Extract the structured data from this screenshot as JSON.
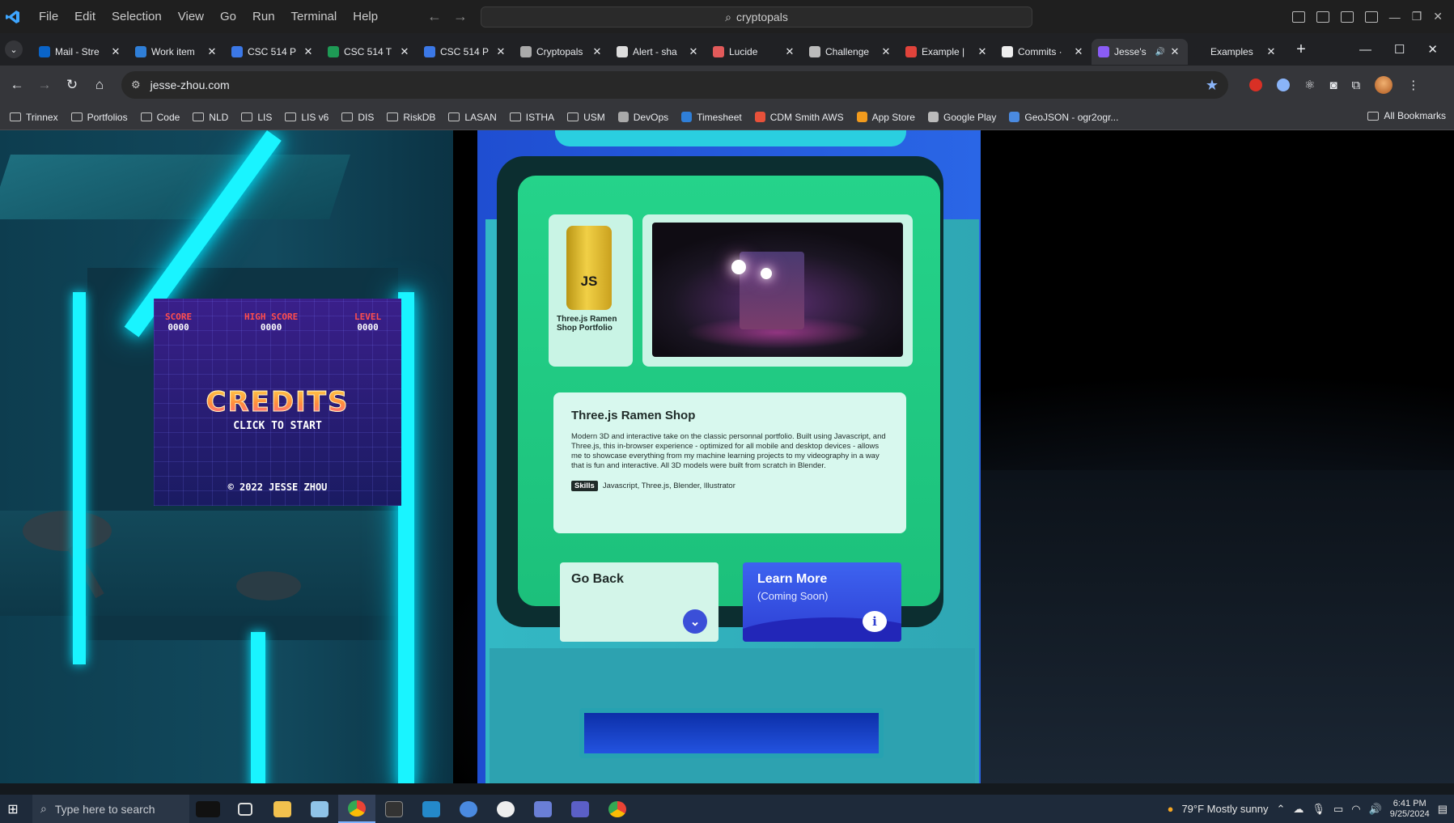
{
  "vscode": {
    "menu": [
      "File",
      "Edit",
      "Selection",
      "View",
      "Go",
      "Run",
      "Terminal",
      "Help"
    ],
    "search": "cryptopals"
  },
  "browser": {
    "tabs": [
      {
        "title": "Mail - Stre",
        "color": "#0a64c8"
      },
      {
        "title": "Work item",
        "color": "#2f7fd8"
      },
      {
        "title": "CSC 514 P",
        "color": "#3b78e7"
      },
      {
        "title": "CSC 514 T",
        "color": "#1e9a55"
      },
      {
        "title": "CSC 514 P",
        "color": "#3b78e7"
      },
      {
        "title": "Cryptopals",
        "color": "#aaaaaa"
      },
      {
        "title": "Alert - sha",
        "color": "#dddddd"
      },
      {
        "title": "Lucide",
        "color": "#e25a5a"
      },
      {
        "title": "Challenge",
        "color": "#bbbbbb"
      },
      {
        "title": "Example |",
        "color": "#e0433b"
      },
      {
        "title": "Commits ·",
        "color": "#eeeeee"
      },
      {
        "title": "Jesse's",
        "color": "#8a5cf6",
        "active": true
      },
      {
        "title": "Examples",
        "color": "#202124"
      }
    ],
    "url": "jesse-zhou.com",
    "bookmarks": [
      {
        "label": "Trinnex",
        "type": "folder"
      },
      {
        "label": "Portfolios",
        "type": "folder"
      },
      {
        "label": "Code",
        "type": "folder"
      },
      {
        "label": "NLD",
        "type": "folder"
      },
      {
        "label": "LIS",
        "type": "folder"
      },
      {
        "label": "LIS v6",
        "type": "folder"
      },
      {
        "label": "DIS",
        "type": "folder"
      },
      {
        "label": "RiskDB",
        "type": "folder"
      },
      {
        "label": "LASAN",
        "type": "folder"
      },
      {
        "label": "ISTHA",
        "type": "folder"
      },
      {
        "label": "USM",
        "type": "folder"
      },
      {
        "label": "DevOps",
        "type": "site"
      },
      {
        "label": "Timesheet",
        "type": "site"
      },
      {
        "label": "CDM Smith AWS",
        "type": "site"
      },
      {
        "label": "App Store",
        "type": "site"
      },
      {
        "label": "Google Play",
        "type": "site"
      },
      {
        "label": "GeoJSON - ogr2ogr...",
        "type": "site"
      }
    ],
    "all_bookmarks": "All Bookmarks"
  },
  "arcade": {
    "score_label": "SCORE",
    "score": "0000",
    "high_score_label": "HIGH SCORE",
    "high_score": "0000",
    "level_label": "LEVEL",
    "level": "0000",
    "title": "CREDITS",
    "prompt": "CLICK TO START",
    "copyright": "© 2022 JESSE ZHOU"
  },
  "kiosk": {
    "can_label": "JS",
    "project_caption": "Three.js Ramen Shop Portfolio",
    "project_title": "Three.js Ramen Shop",
    "description": "Modern 3D and interactive take on the classic personnal portfolio. Built using Javascript, and Three.js, this in-browser experience - optimized for all mobile and desktop devices - allows me to showcase everything from my machine learning projects to my videography in a way that is fun and interactive. All 3D models were built from scratch in Blender.",
    "skills_tag": "Skills",
    "skills": "Javascript, Three.js, Blender, Illustrator",
    "go_back": "Go Back",
    "learn_more": "Learn More",
    "learn_more_sub": "(Coming Soon)"
  },
  "taskbar": {
    "search_placeholder": "Type here to search",
    "weather": "79°F  Mostly sunny",
    "time": "6:41 PM",
    "date": "9/25/2024"
  }
}
